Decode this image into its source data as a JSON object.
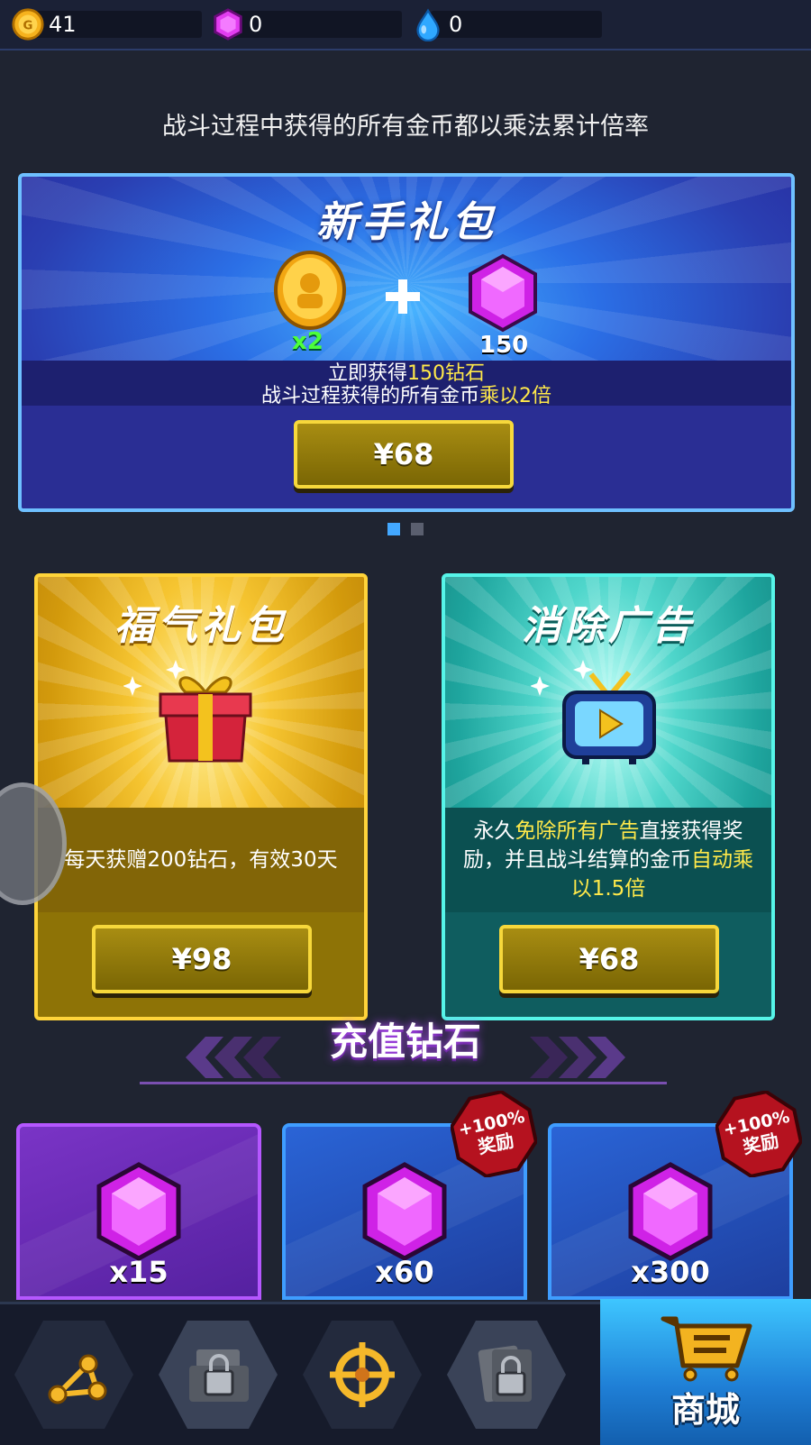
{
  "resources": {
    "gold": "41",
    "gems": "0",
    "water": "0"
  },
  "subtitle": "战斗过程中获得的所有金币都以乘法累计倍率",
  "starter_pack": {
    "title": "新手礼包",
    "coin_multiplier": "x2",
    "gem_amount": "150",
    "desc_line1_pre": "立即获得",
    "desc_line1_hl": "150钻石",
    "desc_line2_pre": "战斗过程获得的所有金币",
    "desc_line2_hl": "乘以2倍",
    "price": "¥68"
  },
  "fortune_pack": {
    "title": "福气礼包",
    "desc": "每天获赠200钻石，有效30天",
    "price": "¥98"
  },
  "remove_ads": {
    "title": "消除广告",
    "desc_pre": "永久",
    "desc_hl1": "免除所有广告",
    "desc_mid": "直接获得奖励，并且战斗结算的金币",
    "desc_hl2": "自动乘以1.5倍",
    "price": "¥68"
  },
  "recharge": {
    "title": "充值钻石",
    "items": [
      {
        "qty": "x15"
      },
      {
        "qty": "x60",
        "bonus_line1": "+100%",
        "bonus_line2": "奖励"
      },
      {
        "qty": "x300",
        "bonus_line1": "+100%",
        "bonus_line2": "奖励"
      }
    ]
  },
  "nav": {
    "shop_label": "商城",
    "icons": [
      "skill-tree-icon",
      "locked-tank-icon",
      "crosshair-icon",
      "locked-cards-icon",
      "shop-cart-icon"
    ]
  },
  "colors": {
    "highlight": "#ffe94a",
    "accent_blue": "#43a8ff",
    "gold_button": "#a88d12"
  }
}
